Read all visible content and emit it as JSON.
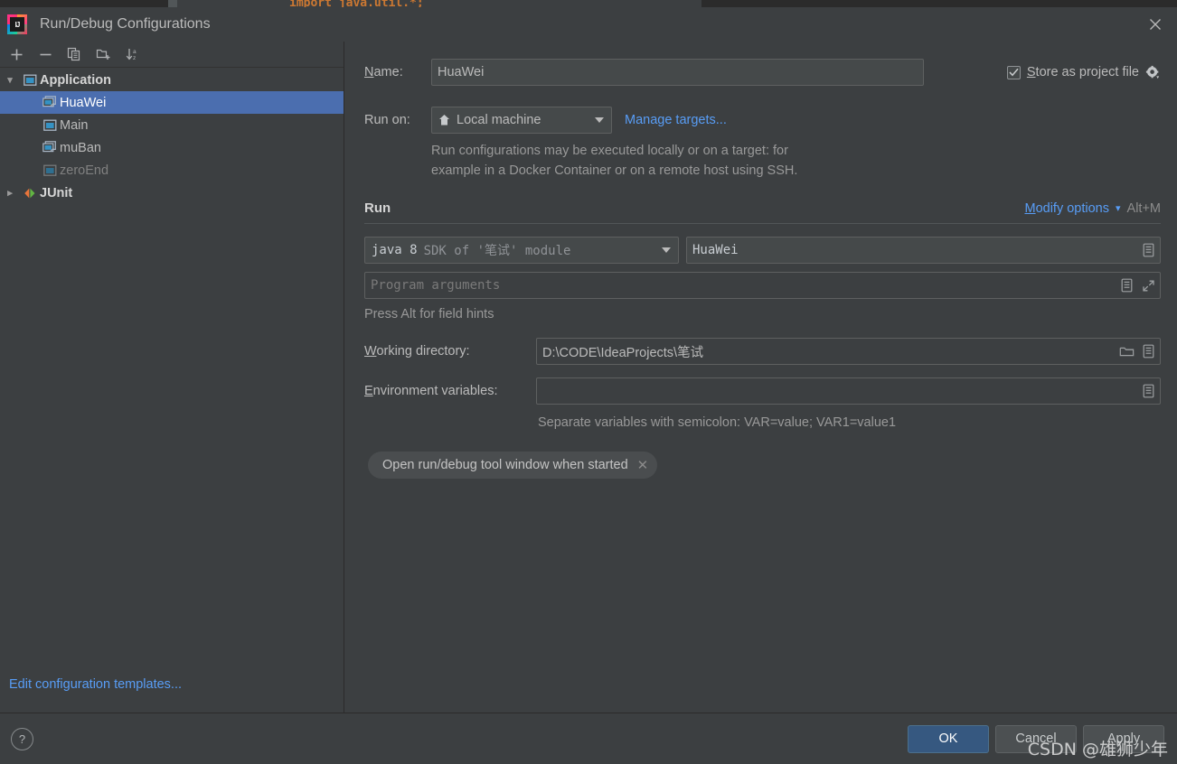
{
  "editor_sliver": {
    "code": "import java.util.*;"
  },
  "window": {
    "title": "Run/Debug Configurations",
    "app_icon": "intellij-idea-logo",
    "close_icon": "close-icon"
  },
  "sidebar": {
    "toolbar": [
      {
        "name": "add-configuration-button",
        "icon": "plus-icon",
        "label": "+"
      },
      {
        "name": "remove-configuration-button",
        "icon": "minus-icon",
        "label": "−"
      },
      {
        "name": "copy-configuration-button",
        "icon": "copy-icon",
        "label": ""
      },
      {
        "name": "new-folder-button",
        "icon": "new-folder-icon",
        "label": ""
      },
      {
        "name": "sort-configurations-button",
        "icon": "sort-az-icon",
        "label": ""
      }
    ],
    "tree": [
      {
        "label": "Application",
        "kind": "group",
        "expanded": true,
        "icon": "application-icon",
        "indent": 0,
        "selected": false,
        "dim": false
      },
      {
        "label": "HuaWei",
        "kind": "item",
        "icon": "run-config-shared-icon",
        "indent": 1,
        "selected": true,
        "dim": false
      },
      {
        "label": "Main",
        "kind": "item",
        "icon": "run-config-icon",
        "indent": 1,
        "selected": false,
        "dim": false
      },
      {
        "label": "muBan",
        "kind": "item",
        "icon": "run-config-shared-icon",
        "indent": 1,
        "selected": false,
        "dim": false
      },
      {
        "label": "zeroEnd",
        "kind": "item",
        "icon": "run-config-temporary-icon",
        "indent": 1,
        "selected": false,
        "dim": true
      },
      {
        "label": "JUnit",
        "kind": "group",
        "expanded": false,
        "icon": "junit-icon",
        "indent": 0,
        "selected": false,
        "dim": false
      }
    ],
    "edit_templates_link": "Edit configuration templates..."
  },
  "form": {
    "name_label": "Name:",
    "name_value": "HuaWei",
    "store_as_project_file_label": "Store as project file",
    "store_as_project_file_checked": true,
    "store_gear_icon": "gear-icon",
    "run_on_label": "Run on:",
    "run_on_value": "Local machine",
    "run_on_icon": "local-machine-icon",
    "manage_targets_link": "Manage targets...",
    "run_on_description_line1": "Run configurations may be executed locally or on a target: for",
    "run_on_description_line2": "example in a Docker Container or on a remote host using SSH.",
    "run_section_title": "Run",
    "modify_options_link": "Modify options",
    "modify_options_shortcut": "Alt+M",
    "modify_options_chevron": "chevron-down-icon",
    "sdk_value_bright": "java 8",
    "sdk_value_gray": "SDK of '笔试' module",
    "main_class_value": "HuaWei",
    "main_class_browse_icon": "expand-list-icon",
    "program_arguments_placeholder": "Program arguments",
    "program_args_macro_icon": "expand-list-icon",
    "program_args_expand_icon": "expand-editor-icon",
    "field_hints": "Press Alt for field hints",
    "working_directory_label": "Working directory:",
    "working_directory_value": "D:\\CODE\\IdeaProjects\\笔试",
    "working_directory_browse_icon": "folder-icon",
    "working_directory_macro_icon": "expand-list-icon",
    "environment_variables_label": "Environment variables:",
    "environment_variables_value": "",
    "environment_variables_browse_icon": "expand-list-icon",
    "environment_variables_hint": "Separate variables with semicolon: VAR=value; VAR1=value1",
    "chip_label": "Open run/debug tool window when started",
    "chip_remove_icon": "close-small-icon"
  },
  "footer": {
    "help_label": "?",
    "ok_label": "OK",
    "cancel_label": "Cancel",
    "apply_label": "Apply"
  },
  "annotation": {
    "shape": "red-ellipse-highlight",
    "color": "#e81a1a",
    "targets": "Modify options"
  },
  "watermark": {
    "text": "CSDN @雄狮少年"
  },
  "colors": {
    "dialog_bg": "#3c3f41",
    "selection_blue": "#4b6eaf",
    "link_blue": "#589df6",
    "primary_button": "#365880",
    "text": "#bbbbbb",
    "annotation_red": "#e81a1a"
  }
}
